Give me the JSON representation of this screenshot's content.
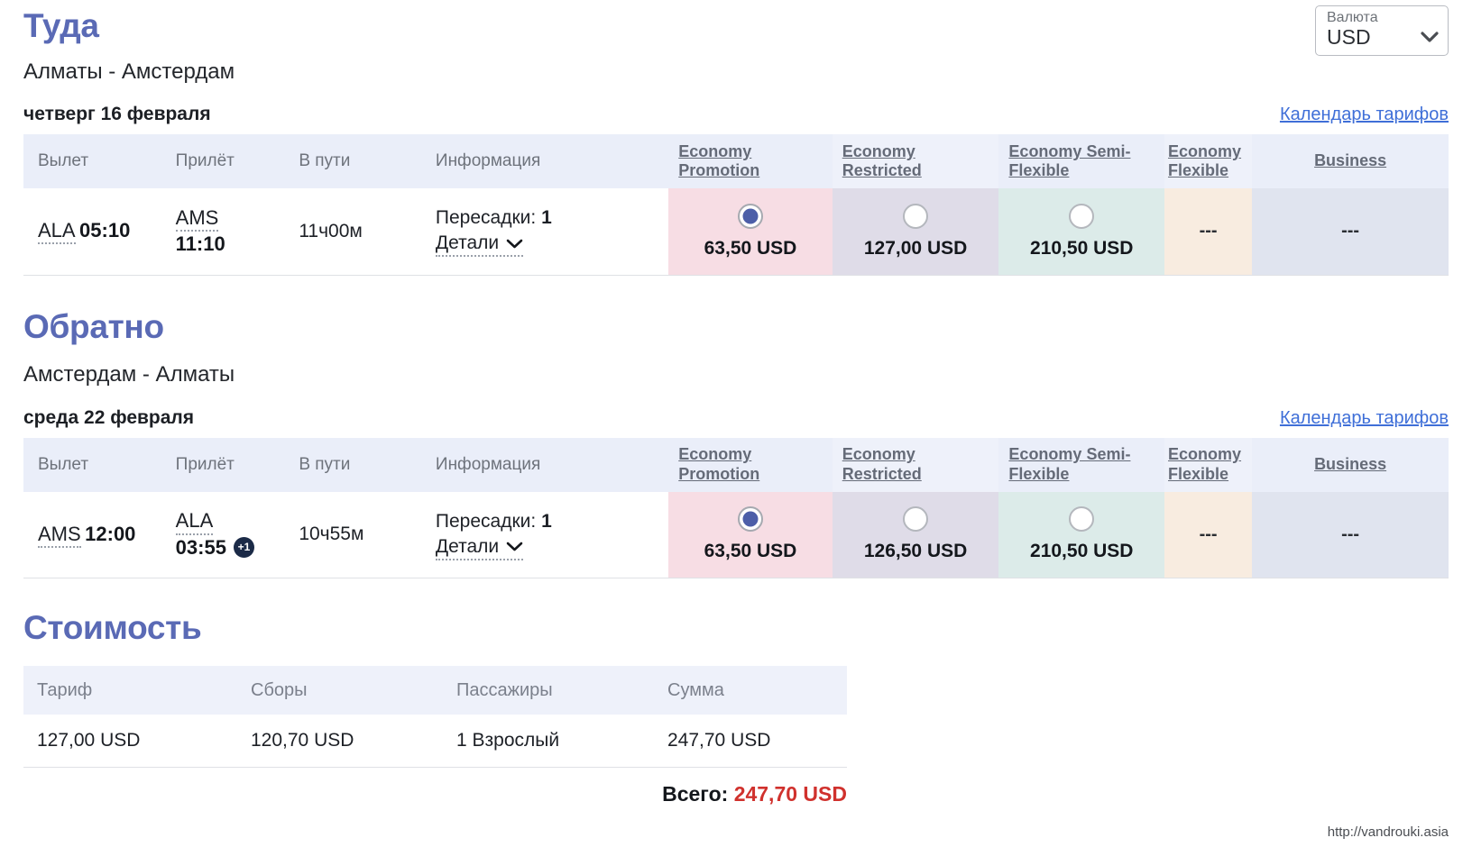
{
  "currency": {
    "label": "Валюта",
    "value": "USD",
    "chevron_icon": "chevron-down-icon"
  },
  "fare_columns": [
    {
      "line1": "Economy",
      "line2": "Promotion",
      "color": "#f7dde4"
    },
    {
      "line1": "Economy",
      "line2": "Restricted",
      "color": "#dfdce8"
    },
    {
      "line1": "Economy Semi-",
      "line2": "Flexible",
      "color": "#dcebe9"
    },
    {
      "line1": "Economy",
      "line2": "Flexible",
      "color": "#f8ece0"
    },
    {
      "line1": "Business",
      "line2": "",
      "color": "#e0e4ef"
    }
  ],
  "column_headers": {
    "departure": "Вылет",
    "arrival": "Прилёт",
    "duration": "В пути",
    "information": "Информация"
  },
  "outbound": {
    "title": "Туда",
    "route": "Алматы - Амстердам",
    "date": "четверг 16 февраля",
    "calendar_link": "Календарь тарифов",
    "flight": {
      "from_code": "ALA",
      "from_time": "05:10",
      "to_code": "AMS",
      "to_time": "11:10",
      "next_day_badge": "",
      "duration": "11ч00м",
      "stops_label": "Пересадки:",
      "stops_value": "1",
      "details_label": "Детали"
    },
    "fares": [
      {
        "type": "radio",
        "selected": true,
        "price": "63,50 USD"
      },
      {
        "type": "radio",
        "selected": false,
        "price": "127,00 USD"
      },
      {
        "type": "radio",
        "selected": false,
        "price": "210,50 USD"
      },
      {
        "type": "none",
        "selected": false,
        "price": "---"
      },
      {
        "type": "none",
        "selected": false,
        "price": "---"
      }
    ]
  },
  "inbound": {
    "title": "Обратно",
    "route": "Амстердам - Алматы",
    "date": "среда 22 февраля",
    "calendar_link": "Календарь тарифов",
    "flight": {
      "from_code": "AMS",
      "from_time": "12:00",
      "to_code": "ALA",
      "to_time": "03:55",
      "next_day_badge": "+1",
      "duration": "10ч55м",
      "stops_label": "Пересадки:",
      "stops_value": "1",
      "details_label": "Детали"
    },
    "fares": [
      {
        "type": "radio",
        "selected": true,
        "price": "63,50 USD"
      },
      {
        "type": "radio",
        "selected": false,
        "price": "126,50 USD"
      },
      {
        "type": "radio",
        "selected": false,
        "price": "210,50 USD"
      },
      {
        "type": "none",
        "selected": false,
        "price": "---"
      },
      {
        "type": "none",
        "selected": false,
        "price": "---"
      }
    ]
  },
  "cost": {
    "title": "Стоимость",
    "headers": [
      "Тариф",
      "Сборы",
      "Пассажиры",
      "Сумма"
    ],
    "row": [
      "127,00 USD",
      "120,70 USD",
      "1 Взрослый",
      "247,70 USD"
    ],
    "total_label": "Всего:",
    "total_value": "247,70 USD"
  },
  "watermark": "http://vandrouki.asia"
}
